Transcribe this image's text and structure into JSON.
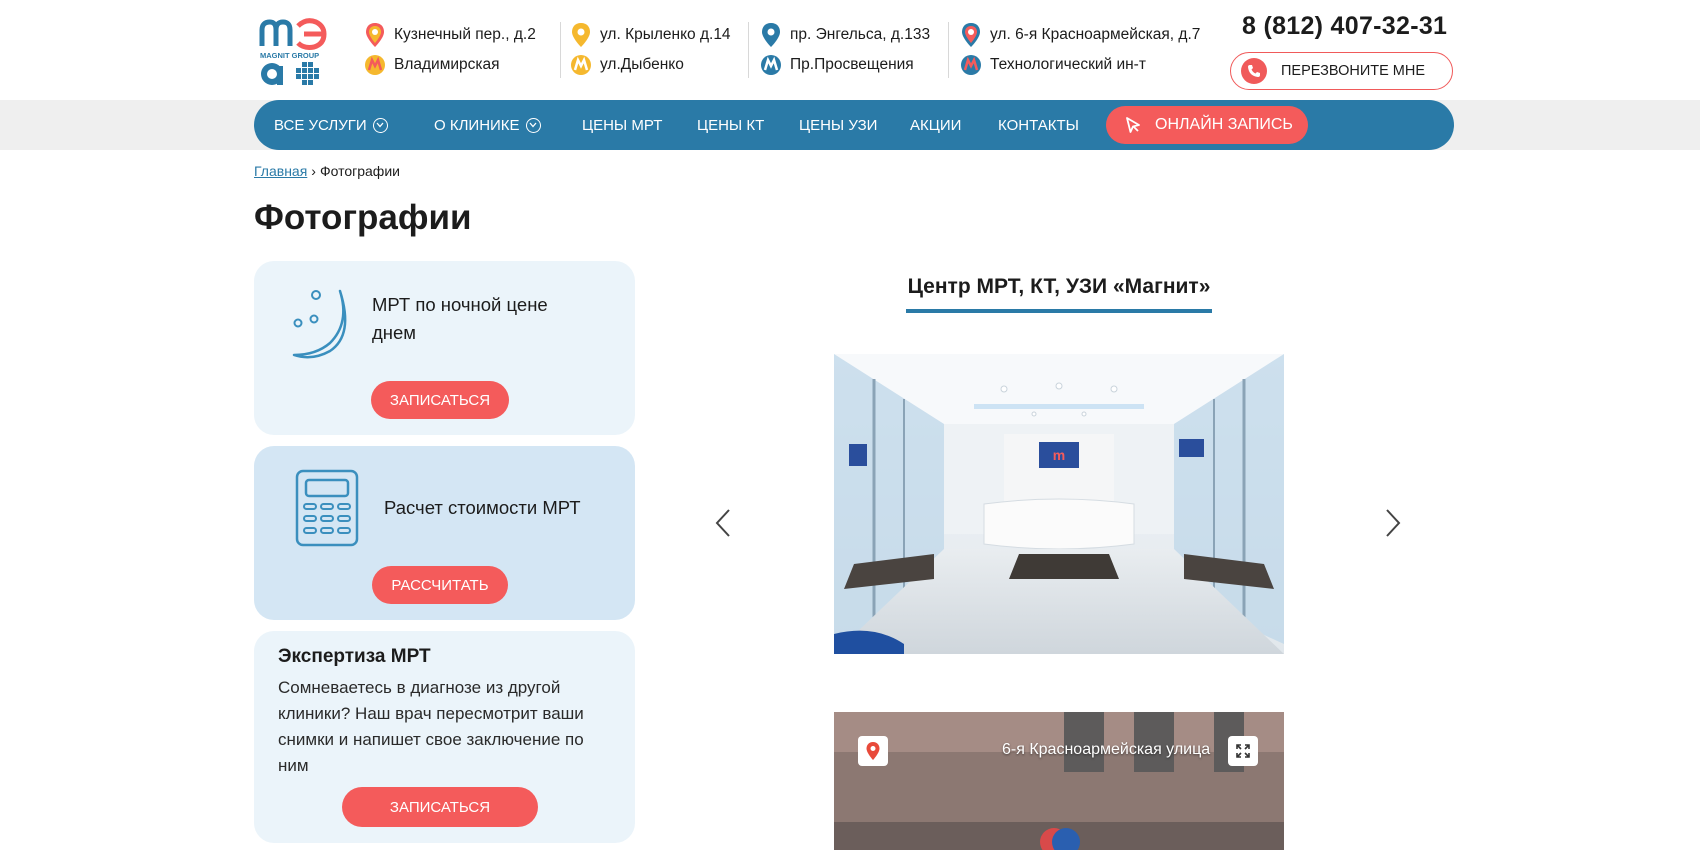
{
  "header": {
    "logo_text": "MAGNIT GROUP",
    "addresses": [
      {
        "street": "Кузнечный пер., д.2",
        "metro": "Владимирская"
      },
      {
        "street": "ул. Крыленко д.14",
        "metro": "ул.Дыбенко"
      },
      {
        "street": "пр. Энгельса, д.133",
        "metro": "Пр.Просвещения"
      },
      {
        "street": "ул. 6-я Красноармейская, д.7",
        "metro": "Технологический ин-т"
      }
    ],
    "phone": "8 (812) 407-32-31",
    "callback_label": "ПЕРЕЗВОНИТЕ МНЕ"
  },
  "nav": {
    "items": [
      {
        "label": "ВСЕ УСЛУГИ"
      },
      {
        "label": "О КЛИНИКЕ"
      },
      {
        "label": "ЦЕНЫ МРТ"
      },
      {
        "label": "ЦЕНЫ КТ"
      },
      {
        "label": "ЦЕНЫ УЗИ"
      },
      {
        "label": "АКЦИИ"
      },
      {
        "label": "КОНТАКТЫ"
      }
    ],
    "online_label": "ОНЛАЙН ЗАПИСЬ"
  },
  "breadcrumb": {
    "home": "Главная",
    "separator": "›",
    "current": "Фотографии"
  },
  "page_title": "Фотографии",
  "sidebar": {
    "night_card": {
      "text": "МРТ по ночной цене днем",
      "button": "ЗАПИСАТЬСЯ"
    },
    "calc_card": {
      "text": "Расчет стоимости МРТ",
      "button": "РАССЧИТАТЬ"
    },
    "expert_card": {
      "title": "Экспертиза МРТ",
      "text": "Сомневаетесь в диагнозе из другой клиники? Наш врач пересмотрит ваши снимки и напишет свое заключение по ним",
      "button": "ЗАПИСАТЬСЯ"
    }
  },
  "gallery": {
    "title": "Центр МРТ, КТ, УЗИ «Магнит»",
    "street_view_label": "6-я Красноармейская улица"
  },
  "colors": {
    "brand_blue": "#2a7aa7",
    "accent_red": "#f45b5b",
    "card_light": "#ebf4fa",
    "card_mid": "#d4e6f4"
  },
  "icons": [
    "location-pin-icon",
    "metro-icon",
    "phone-icon",
    "chevron-down-icon",
    "cursor-click-icon",
    "moon-icon",
    "calculator-icon",
    "arrow-left-icon",
    "arrow-right-icon",
    "map-pin-icon",
    "expand-icon"
  ]
}
